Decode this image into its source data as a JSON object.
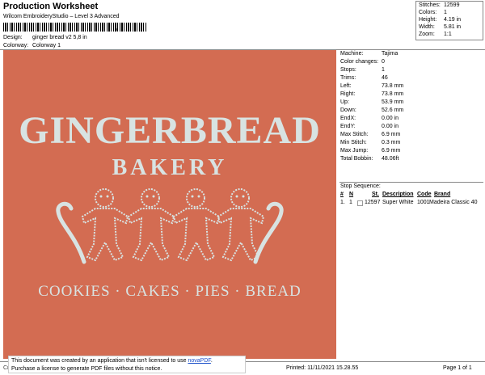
{
  "header": {
    "title": "Production Worksheet",
    "subtitle": "Wilcom EmbroideryStudio – Level 3 Advanced",
    "barcode_suffix": ",",
    "design_label": "Design:",
    "design_value": "ginger bread v2 5,8 in",
    "colorway_label": "Colorway:",
    "colorway_value": "Colorway 1"
  },
  "stats": [
    {
      "k": "Stitches:",
      "v": "12599"
    },
    {
      "k": "Colors:",
      "v": "1"
    },
    {
      "k": "Height:",
      "v": "4.19 in"
    },
    {
      "k": "Width:",
      "v": "5.81 in"
    },
    {
      "k": "Zoom:",
      "v": "1:1"
    }
  ],
  "design": {
    "background": "#d36c52",
    "thread_color": "#d8e3e2",
    "line1": "GINGERBREAD",
    "line2": "BAKERY",
    "line3": "COOKIES · CAKES · PIES · BREAD"
  },
  "machine_info": [
    {
      "k": "Machine:",
      "v": "Tajima"
    },
    {
      "k": "Color changes:",
      "v": "0"
    },
    {
      "k": "Stops:",
      "v": "1"
    },
    {
      "k": "Trims:",
      "v": "46"
    },
    {
      "k": "Left:",
      "v": "73.8 mm"
    },
    {
      "k": "Right:",
      "v": "73.8 mm"
    },
    {
      "k": "Up:",
      "v": "53.9 mm"
    },
    {
      "k": "Down:",
      "v": "52.6 mm"
    },
    {
      "k": "EndX:",
      "v": "0.00 in"
    },
    {
      "k": "EndY:",
      "v": "0.00 in"
    },
    {
      "k": "Max Stitch:",
      "v": "6.9 mm"
    },
    {
      "k": "Min Stitch:",
      "v": "0.3 mm"
    },
    {
      "k": "Max Jump:",
      "v": "6.9 mm"
    },
    {
      "k": "Total Bobbin:",
      "v": "48.06ft"
    }
  ],
  "stop_sequence": {
    "title": "Stop Sequence:",
    "headers": [
      "#",
      "N",
      "St.",
      "Description",
      "Code",
      "Brand"
    ],
    "rows": [
      [
        "1.",
        "1",
        "12597",
        "Super White",
        "1001",
        "Madeira Classic 40"
      ]
    ]
  },
  "footer": {
    "cr": "Cr",
    "notice_line1": "This document was created by an application that isn't licensed to use",
    "notice_link": "novaPDF",
    "notice_line1_end": ".",
    "notice_line2": "Purchase a license to generate PDF files without this notice.",
    "printed": "Printed: 11/11/2021 15.28.55",
    "page": "Page 1 of 1"
  }
}
